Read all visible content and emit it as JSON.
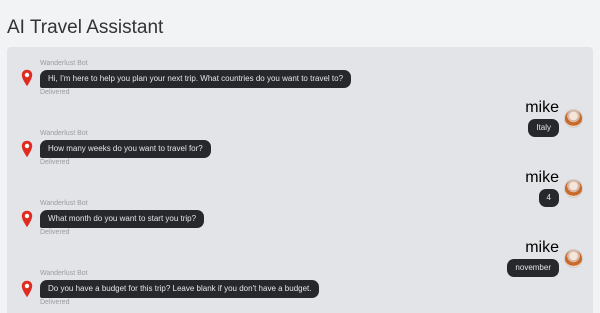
{
  "page": {
    "title": "AI Travel Assistant"
  },
  "colors": {
    "bubble_bg": "#26282c",
    "pin_red": "#e02b20",
    "panel_bg": "#e3e4e7"
  },
  "icons": {
    "bot": "map-pin-icon",
    "user": "user-avatar"
  },
  "messages": [
    {
      "sender": "bot",
      "name": "Wanderlust Bot",
      "text": "Hi, I'm here to help you plan your next trip. What countries do you want to travel to?",
      "status": "Delivered"
    },
    {
      "sender": "user",
      "name": "mike",
      "text": "Italy"
    },
    {
      "sender": "bot",
      "name": "Wanderlust Bot",
      "text": "How many weeks do you want to travel for?",
      "status": "Delivered"
    },
    {
      "sender": "user",
      "name": "mike",
      "text": "4"
    },
    {
      "sender": "bot",
      "name": "Wanderlust Bot",
      "text": "What month do you want to start you trip?",
      "status": "Delivered"
    },
    {
      "sender": "user",
      "name": "mike",
      "text": "november"
    },
    {
      "sender": "bot",
      "name": "Wanderlust Bot",
      "text": "Do you have a budget for this trip? Leave blank if you don't have a budget.",
      "status": "Delivered"
    }
  ]
}
